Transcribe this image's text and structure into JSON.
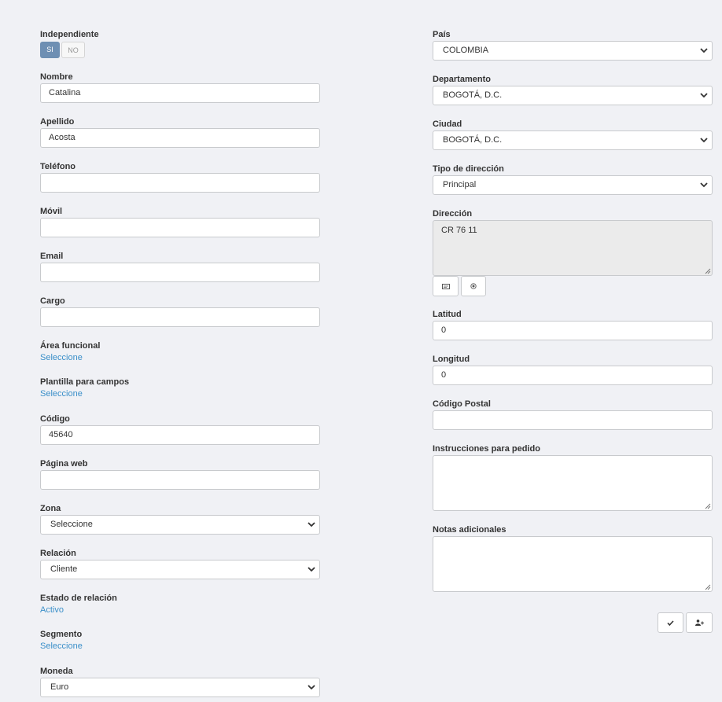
{
  "left": {
    "independiente": {
      "label": "Independiente",
      "yes": "SI",
      "no": "NO"
    },
    "nombre": {
      "label": "Nombre",
      "value": "Catalina"
    },
    "apellido": {
      "label": "Apellido",
      "value": "Acosta"
    },
    "telefono": {
      "label": "Teléfono",
      "value": ""
    },
    "movil": {
      "label": "Móvil",
      "value": ""
    },
    "email": {
      "label": "Email",
      "value": ""
    },
    "cargo": {
      "label": "Cargo",
      "value": ""
    },
    "area_funcional": {
      "label": "Área funcional",
      "value": "Seleccione"
    },
    "plantilla": {
      "label": "Plantilla para campos",
      "value": "Seleccione"
    },
    "codigo": {
      "label": "Código",
      "value": "45640"
    },
    "pagina_web": {
      "label": "Página web",
      "value": ""
    },
    "zona": {
      "label": "Zona",
      "value": "Seleccione"
    },
    "relacion": {
      "label": "Relación",
      "value": "Cliente"
    },
    "estado_relacion": {
      "label": "Estado de relación",
      "value": "Activo"
    },
    "segmento": {
      "label": "Segmento",
      "value": "Seleccione"
    },
    "moneda": {
      "label": "Moneda",
      "value": "Euro"
    }
  },
  "right": {
    "pais": {
      "label": "País",
      "value": "COLOMBIA"
    },
    "departamento": {
      "label": "Departamento",
      "value": "BOGOTÁ, D.C."
    },
    "ciudad": {
      "label": "Ciudad",
      "value": "BOGOTÁ, D.C."
    },
    "tipo_direccion": {
      "label": "Tipo de dirección",
      "value": "Principal"
    },
    "direccion": {
      "label": "Dirección",
      "value": "CR 76 11",
      "buttons": [
        "address-card-icon",
        "target-icon"
      ]
    },
    "latitud": {
      "label": "Latitud",
      "value": "0"
    },
    "longitud": {
      "label": "Longitud",
      "value": "0"
    },
    "codigo_postal": {
      "label": "Código Postal",
      "value": ""
    },
    "instrucciones": {
      "label": "Instrucciones para pedido",
      "value": ""
    },
    "notas": {
      "label": "Notas adicionales",
      "value": ""
    }
  },
  "actions": [
    "check-icon",
    "add-user-icon"
  ],
  "colors": {
    "accent": "#6e8fb3",
    "link": "#3a8fc9",
    "background": "#f0f1f5"
  }
}
